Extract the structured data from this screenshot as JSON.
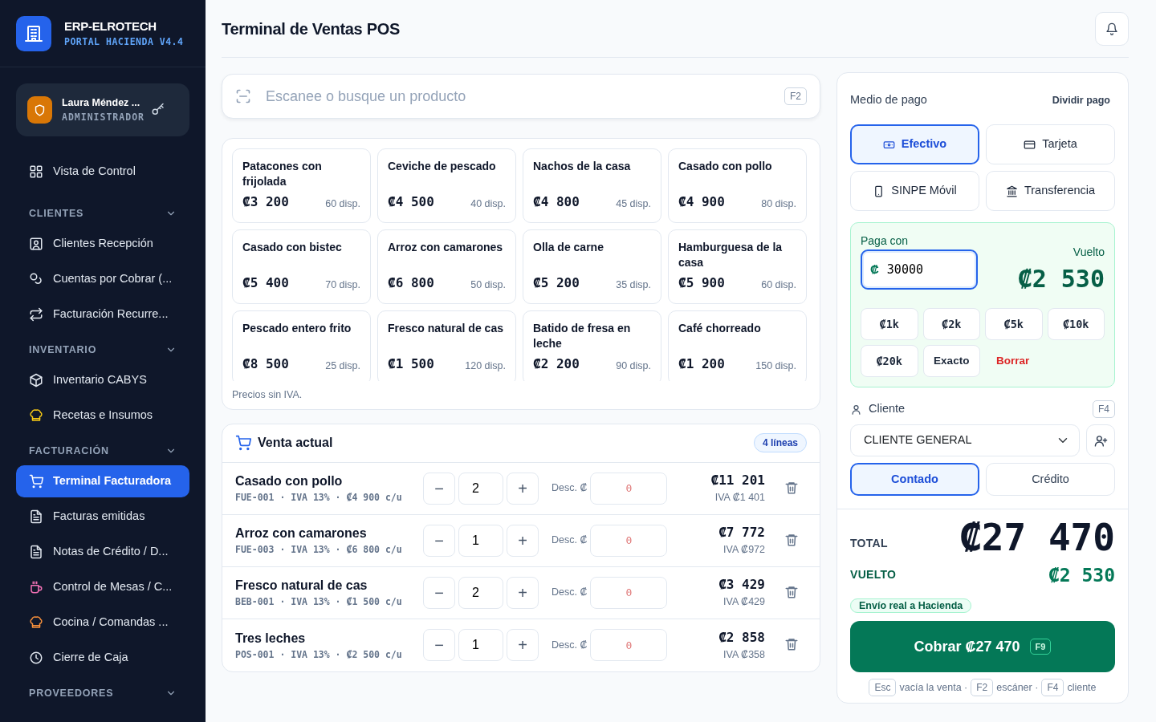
{
  "brand": {
    "name": "ERP-ELROTECH",
    "subtitle": "PORTAL HACIENDA V4.4"
  },
  "user": {
    "name": "Laura Méndez ...",
    "role": "ADMINISTRADOR"
  },
  "nav": [
    {
      "kind": "item",
      "label": "Vista de Control",
      "selected": false
    },
    {
      "kind": "section",
      "label": "CLIENTES",
      "expanded": true,
      "children": [
        {
          "label": "Clientes Recepción",
          "selected": false
        },
        {
          "label": "Cuentas por Cobrar (...",
          "selected": false
        },
        {
          "label": "Facturación Recurre...",
          "selected": false
        }
      ]
    },
    {
      "kind": "section",
      "label": "INVENTARIO",
      "expanded": true,
      "children": [
        {
          "label": "Inventario CABYS",
          "selected": false
        },
        {
          "label": "Recetas e Insumos",
          "selected": false
        }
      ]
    },
    {
      "kind": "section",
      "label": "FACTURACIÓN",
      "expanded": true,
      "children": [
        {
          "label": "Terminal Facturadora",
          "selected": true
        },
        {
          "label": "Facturas emitidas",
          "selected": false
        },
        {
          "label": "Notas de Crédito / D...",
          "selected": false
        },
        {
          "label": "Control de Mesas / C...",
          "selected": false
        },
        {
          "label": "Cocina / Comandas ...",
          "selected": false
        },
        {
          "label": "Cierre de Caja",
          "selected": false
        }
      ]
    },
    {
      "kind": "section",
      "label": "PROVEEDORES",
      "expanded": true
    }
  ],
  "page": {
    "title": "Terminal de Ventas POS"
  },
  "search": {
    "placeholder": "Escanee o busque un producto",
    "shortcut": "F2"
  },
  "products": {
    "items": [
      {
        "name": "Patacones con frijolada",
        "price": "₡3 200",
        "stock": "60 disp."
      },
      {
        "name": "Ceviche de pescado",
        "price": "₡4 500",
        "stock": "40 disp."
      },
      {
        "name": "Nachos de la casa",
        "price": "₡4 800",
        "stock": "45 disp."
      },
      {
        "name": "Casado con pollo",
        "price": "₡4 900",
        "stock": "80 disp."
      },
      {
        "name": "Casado con bistec",
        "price": "₡5 400",
        "stock": "70 disp."
      },
      {
        "name": "Arroz con camarones",
        "price": "₡6 800",
        "stock": "50 disp."
      },
      {
        "name": "Olla de carne",
        "price": "₡5 200",
        "stock": "35 disp."
      },
      {
        "name": "Hamburguesa de la casa",
        "price": "₡5 900",
        "stock": "60 disp."
      },
      {
        "name": "Pescado entero frito",
        "price": "₡8 500",
        "stock": "25 disp."
      },
      {
        "name": "Fresco natural de cas",
        "price": "₡1 500",
        "stock": "120 disp."
      },
      {
        "name": "Batido de fresa en leche",
        "price": "₡2 200",
        "stock": "90 disp."
      },
      {
        "name": "Café chorreado",
        "price": "₡1 200",
        "stock": "150 disp."
      }
    ],
    "note": "Precios sin IVA."
  },
  "sale": {
    "title": "Venta actual",
    "count": "4 líneas",
    "lines": [
      {
        "name": "Casado con pollo",
        "meta": "FUE-001 · IVA 13% · ₡4 900 c/u",
        "decrease": "−",
        "qty": "2",
        "increase": "+",
        "discount_label": "Desc. ₡",
        "discount": "0",
        "total": "₡11 201",
        "iva": "IVA ₡1 401"
      },
      {
        "name": "Arroz con camarones",
        "meta": "FUE-003 · IVA 13% · ₡6 800 c/u",
        "decrease": "−",
        "qty": "1",
        "increase": "+",
        "discount_label": "Desc. ₡",
        "discount": "0",
        "total": "₡7 772",
        "iva": "IVA ₡972"
      },
      {
        "name": "Fresco natural de cas",
        "meta": "BEB-001 · IVA 13% · ₡1 500 c/u",
        "decrease": "−",
        "qty": "2",
        "increase": "+",
        "discount_label": "Desc. ₡",
        "discount": "0",
        "total": "₡3 429",
        "iva": "IVA ₡429"
      },
      {
        "name": "Tres leches",
        "meta": "POS-001 · IVA 13% · ₡2 500 c/u",
        "decrease": "−",
        "qty": "1",
        "increase": "+",
        "discount_label": "Desc. ₡",
        "discount": "0",
        "total": "₡2 858",
        "iva": "IVA ₡358"
      }
    ]
  },
  "payment": {
    "title": "Medio de pago",
    "split": "Dividir pago",
    "methods": [
      {
        "label": "Efectivo",
        "selected": true
      },
      {
        "label": "Tarjeta",
        "selected": false
      },
      {
        "label": "SINPE Móvil",
        "selected": false
      },
      {
        "label": "Transferencia",
        "selected": false
      }
    ],
    "cash": {
      "label": "Paga con",
      "currency": "₡",
      "value": "30000",
      "change_label": "Vuelto",
      "change": "₡2 530",
      "quick": [
        {
          "kind": "amount",
          "label": "₡1k"
        },
        {
          "kind": "amount",
          "label": "₡2k"
        },
        {
          "kind": "amount",
          "label": "₡5k"
        },
        {
          "kind": "amount",
          "label": "₡10k"
        },
        {
          "kind": "amount",
          "label": "₡20k"
        },
        {
          "kind": "exact",
          "label": "Exacto"
        },
        {
          "kind": "clear",
          "label": "Borrar"
        }
      ]
    }
  },
  "client": {
    "label": "Cliente",
    "shortcut": "F4",
    "value": "CLIENTE GENERAL",
    "terms": [
      {
        "label": "Contado",
        "selected": true
      },
      {
        "label": "Crédito",
        "selected": false
      }
    ]
  },
  "summary": {
    "total_label": "TOTAL",
    "total": "₡27 470",
    "change_label": "VUELTO",
    "change": "₡2 530",
    "badge": "Envío real a Hacienda",
    "charge": "Cobrar ₡27 470",
    "charge_key": "F9",
    "hints": [
      {
        "key": "Esc",
        "text": "vacía la venta ·"
      },
      {
        "key": "F2",
        "text": "escáner ·"
      },
      {
        "key": "F4",
        "text": "cliente"
      }
    ]
  }
}
